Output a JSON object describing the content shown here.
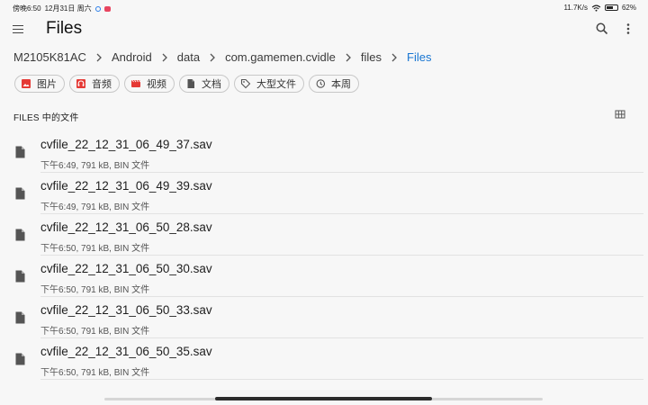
{
  "status_bar": {
    "time": "傍晚6:50",
    "date": "12月31日 周六",
    "net_speed": "11.7K/s",
    "battery": "62%",
    "battery_level": 0.62
  },
  "app_bar": {
    "title": "Files",
    "menu_icon": "menu-icon",
    "search_icon": "search-icon",
    "more_icon": "more-vert-icon"
  },
  "breadcrumb": [
    "M2105K81AC",
    "Android",
    "data",
    "com.gamemen.cvidle",
    "files",
    "Files"
  ],
  "chips": [
    {
      "label": "图片",
      "icon": "image-icon",
      "color": "#e53935"
    },
    {
      "label": "音频",
      "icon": "headphones-icon",
      "color": "#e53935"
    },
    {
      "label": "视频",
      "icon": "movie-icon",
      "color": "#e53935"
    },
    {
      "label": "文档",
      "icon": "document-icon",
      "color": "#555555"
    },
    {
      "label": "大型文件",
      "icon": "tag-icon",
      "color": "#555555"
    },
    {
      "label": "本周",
      "icon": "history-icon",
      "color": "#555555"
    }
  ],
  "section": {
    "title": "FILES 中的文件",
    "view_icon": "grid-view-icon"
  },
  "files": [
    {
      "name": "cvfile_22_12_31_06_49_37.sav",
      "meta": "下午6:49, 791 kB, BIN 文件"
    },
    {
      "name": "cvfile_22_12_31_06_49_39.sav",
      "meta": "下午6:49, 791 kB, BIN 文件"
    },
    {
      "name": "cvfile_22_12_31_06_50_28.sav",
      "meta": "下午6:50, 791 kB, BIN 文件"
    },
    {
      "name": "cvfile_22_12_31_06_50_30.sav",
      "meta": "下午6:50, 791 kB, BIN 文件"
    },
    {
      "name": "cvfile_22_12_31_06_50_33.sav",
      "meta": "下午6:50, 791 kB, BIN 文件"
    },
    {
      "name": "cvfile_22_12_31_06_50_35.sav",
      "meta": "下午6:50, 791 kB, BIN 文件"
    }
  ],
  "colors": {
    "accent": "#1976d2",
    "background": "#f7f7f7"
  }
}
